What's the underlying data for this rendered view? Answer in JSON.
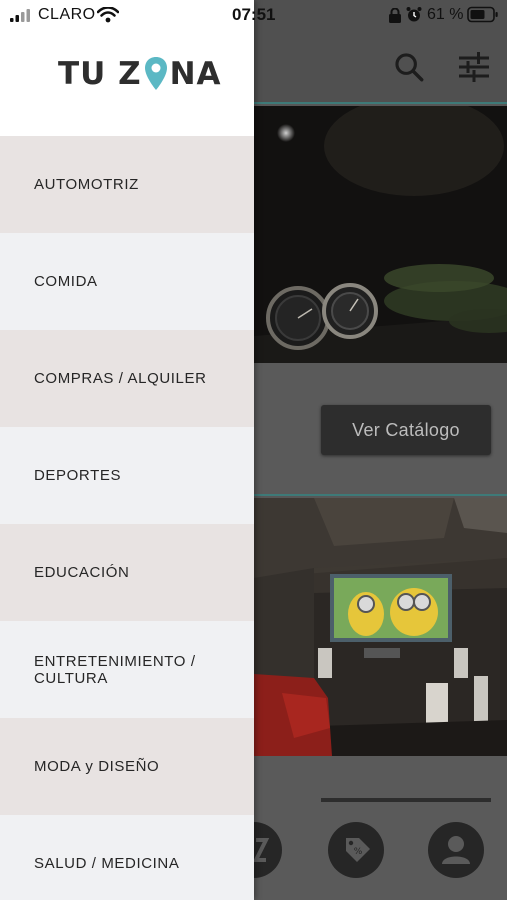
{
  "status_bar": {
    "carrier": "CLARO",
    "time": "07:51",
    "battery_percent": "61 %"
  },
  "brand": {
    "text_before_pin": "TU Z",
    "text_after_pin": "NA",
    "pin_color": "#5bb8c4"
  },
  "categories": [
    {
      "label": "AUTOMOTRIZ"
    },
    {
      "label": "COMIDA"
    },
    {
      "label": "COMPRAS / ALQUILER"
    },
    {
      "label": "DEPORTES"
    },
    {
      "label": "EDUCACIÓN"
    },
    {
      "label": "ENTRETENIMIENTO / CULTURA"
    },
    {
      "label": "MODA y DISEÑO"
    },
    {
      "label": "SALUD / MEDICINA"
    }
  ],
  "background_app": {
    "catalog_button_label": "Ver Catálogo",
    "header_icons": [
      "search-icon",
      "filter-sliders-icon"
    ],
    "bottom_nav_icons": [
      "map-icon",
      "discount-tag-icon",
      "user-profile-icon"
    ]
  },
  "colors": {
    "accent_teal": "#3e7a78",
    "shaded_row": "#e8e3e2",
    "light_row": "#f0f1f3"
  }
}
